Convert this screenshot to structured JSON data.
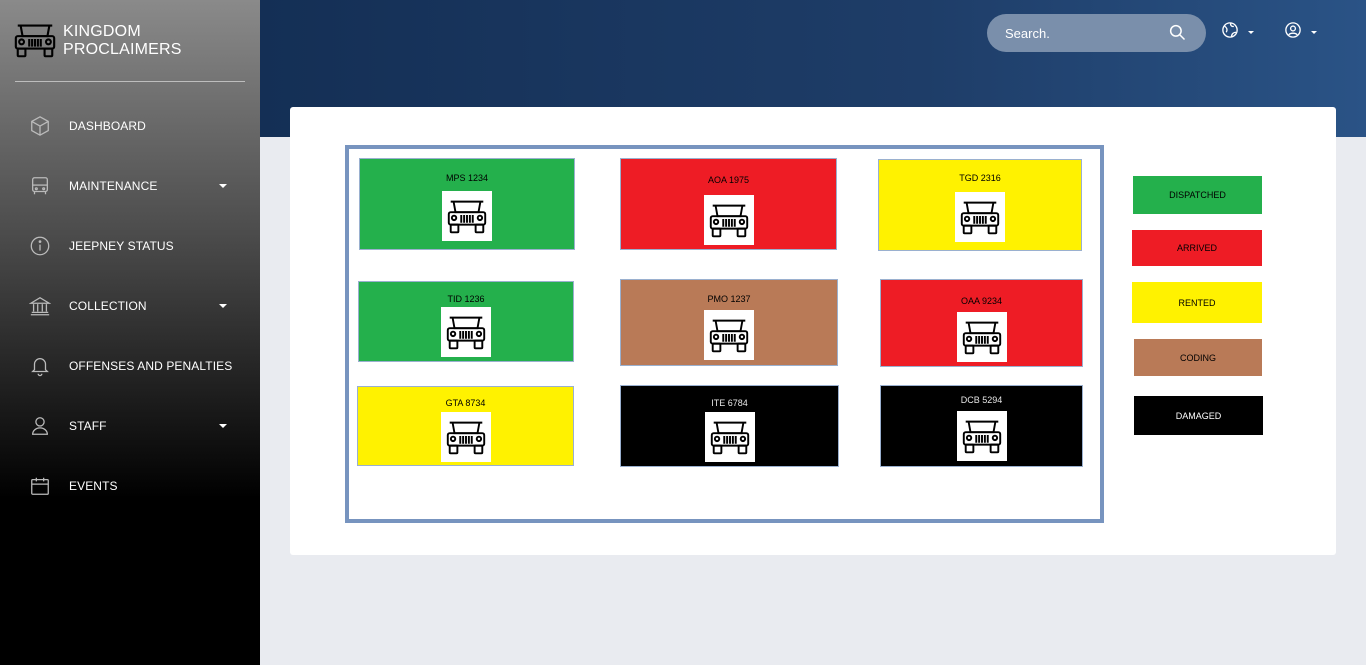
{
  "app": {
    "brand": "KINGDOM PROCLAIMERS"
  },
  "sidebar": {
    "items": [
      {
        "label": "DASHBOARD",
        "icon": "box-icon",
        "has_submenu": false
      },
      {
        "label": "MAINTENANCE",
        "icon": "bus-icon",
        "has_submenu": true
      },
      {
        "label": "JEEPNEY STATUS",
        "icon": "info-icon",
        "has_submenu": false
      },
      {
        "label": "COLLECTION",
        "icon": "bank-icon",
        "has_submenu": true
      },
      {
        "label": "OFFENSES AND PENALTIES",
        "icon": "bell-icon",
        "has_submenu": false
      },
      {
        "label": "STAFF",
        "icon": "user-icon",
        "has_submenu": true
      },
      {
        "label": "EVENTS",
        "icon": "calendar-icon",
        "has_submenu": false
      }
    ]
  },
  "header": {
    "search_placeholder": "Search.",
    "icons": [
      "globe-icon",
      "user-circle-icon"
    ]
  },
  "jeepneys": [
    {
      "plate": "MPS 1234",
      "status": "DISPATCHED"
    },
    {
      "plate": "AOA 1975",
      "status": "ARRIVED"
    },
    {
      "plate": "TGD 2316",
      "status": "RENTED"
    },
    {
      "plate": "TID 1236",
      "status": "DISPATCHED"
    },
    {
      "plate": "PMO 1237",
      "status": "CODING"
    },
    {
      "plate": "OAA 9234",
      "status": "ARRIVED"
    },
    {
      "plate": "GTA 8734",
      "status": "RENTED"
    },
    {
      "plate": "ITE 6784",
      "status": "DAMAGED"
    },
    {
      "plate": "DCB 5294",
      "status": "DAMAGED"
    }
  ],
  "legend": [
    {
      "label": "DISPATCHED",
      "color": "#24b04c"
    },
    {
      "label": "ARRIVED",
      "color": "#ee1c25"
    },
    {
      "label": "RENTED",
      "color": "#fff200"
    },
    {
      "label": "CODING",
      "color": "#b97a57"
    },
    {
      "label": "DAMAGED",
      "color": "#000000"
    }
  ]
}
